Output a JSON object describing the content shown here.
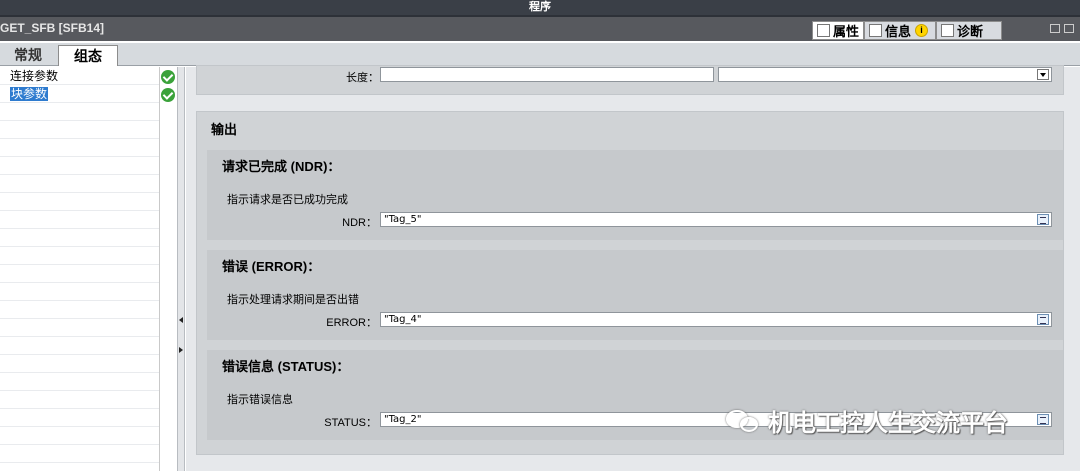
{
  "top_title": "程序",
  "object_title": "GET_SFB [SFB14]",
  "property_tabs": [
    {
      "label": "属性"
    },
    {
      "label": "信息"
    },
    {
      "label": "诊断"
    }
  ],
  "info_badge": "i",
  "sub_tabs": [
    {
      "label": "常规"
    },
    {
      "label": "组态"
    }
  ],
  "nav": [
    {
      "label": "连接参数"
    },
    {
      "label": "块参数"
    }
  ],
  "length_row": {
    "label": "长度：",
    "value": "",
    "dropdown_value": ""
  },
  "output_section": {
    "title": "输出",
    "groups": [
      {
        "title": "请求已完成 (NDR)：",
        "desc": "指示请求是否已成功完成",
        "param": "NDR：",
        "value": "\"Tag_5\""
      },
      {
        "title": "错误 (ERROR)：",
        "desc": "指示处理请求期间是否出错",
        "param": "ERROR：",
        "value": "\"Tag_4\""
      },
      {
        "title": "错误信息 (STATUS)：",
        "desc": "指示错误信息",
        "param": "STATUS：",
        "value": "\"Tag_2\""
      }
    ]
  },
  "watermark": "机电工控人生交流平台",
  "colors": {
    "top_bar": "#3a3f47",
    "title_bar": "#57595e",
    "selection": "#2e7bcf",
    "check": "#3aa23a"
  }
}
